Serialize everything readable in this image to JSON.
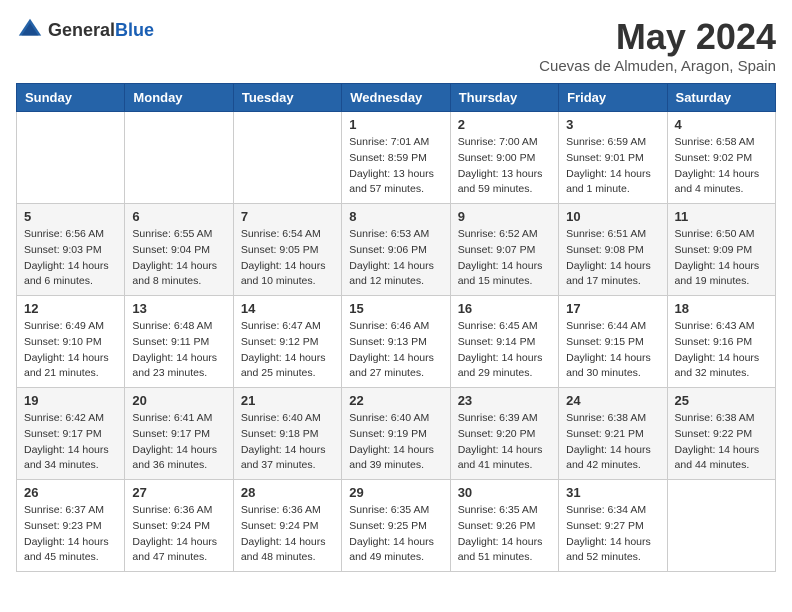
{
  "header": {
    "logo_general": "General",
    "logo_blue": "Blue",
    "month_title": "May 2024",
    "location": "Cuevas de Almuden, Aragon, Spain"
  },
  "weekdays": [
    "Sunday",
    "Monday",
    "Tuesday",
    "Wednesday",
    "Thursday",
    "Friday",
    "Saturday"
  ],
  "weeks": [
    [
      {
        "day": "",
        "info": ""
      },
      {
        "day": "",
        "info": ""
      },
      {
        "day": "",
        "info": ""
      },
      {
        "day": "1",
        "info": "Sunrise: 7:01 AM\nSunset: 8:59 PM\nDaylight: 13 hours\nand 57 minutes."
      },
      {
        "day": "2",
        "info": "Sunrise: 7:00 AM\nSunset: 9:00 PM\nDaylight: 13 hours\nand 59 minutes."
      },
      {
        "day": "3",
        "info": "Sunrise: 6:59 AM\nSunset: 9:01 PM\nDaylight: 14 hours\nand 1 minute."
      },
      {
        "day": "4",
        "info": "Sunrise: 6:58 AM\nSunset: 9:02 PM\nDaylight: 14 hours\nand 4 minutes."
      }
    ],
    [
      {
        "day": "5",
        "info": "Sunrise: 6:56 AM\nSunset: 9:03 PM\nDaylight: 14 hours\nand 6 minutes."
      },
      {
        "day": "6",
        "info": "Sunrise: 6:55 AM\nSunset: 9:04 PM\nDaylight: 14 hours\nand 8 minutes."
      },
      {
        "day": "7",
        "info": "Sunrise: 6:54 AM\nSunset: 9:05 PM\nDaylight: 14 hours\nand 10 minutes."
      },
      {
        "day": "8",
        "info": "Sunrise: 6:53 AM\nSunset: 9:06 PM\nDaylight: 14 hours\nand 12 minutes."
      },
      {
        "day": "9",
        "info": "Sunrise: 6:52 AM\nSunset: 9:07 PM\nDaylight: 14 hours\nand 15 minutes."
      },
      {
        "day": "10",
        "info": "Sunrise: 6:51 AM\nSunset: 9:08 PM\nDaylight: 14 hours\nand 17 minutes."
      },
      {
        "day": "11",
        "info": "Sunrise: 6:50 AM\nSunset: 9:09 PM\nDaylight: 14 hours\nand 19 minutes."
      }
    ],
    [
      {
        "day": "12",
        "info": "Sunrise: 6:49 AM\nSunset: 9:10 PM\nDaylight: 14 hours\nand 21 minutes."
      },
      {
        "day": "13",
        "info": "Sunrise: 6:48 AM\nSunset: 9:11 PM\nDaylight: 14 hours\nand 23 minutes."
      },
      {
        "day": "14",
        "info": "Sunrise: 6:47 AM\nSunset: 9:12 PM\nDaylight: 14 hours\nand 25 minutes."
      },
      {
        "day": "15",
        "info": "Sunrise: 6:46 AM\nSunset: 9:13 PM\nDaylight: 14 hours\nand 27 minutes."
      },
      {
        "day": "16",
        "info": "Sunrise: 6:45 AM\nSunset: 9:14 PM\nDaylight: 14 hours\nand 29 minutes."
      },
      {
        "day": "17",
        "info": "Sunrise: 6:44 AM\nSunset: 9:15 PM\nDaylight: 14 hours\nand 30 minutes."
      },
      {
        "day": "18",
        "info": "Sunrise: 6:43 AM\nSunset: 9:16 PM\nDaylight: 14 hours\nand 32 minutes."
      }
    ],
    [
      {
        "day": "19",
        "info": "Sunrise: 6:42 AM\nSunset: 9:17 PM\nDaylight: 14 hours\nand 34 minutes."
      },
      {
        "day": "20",
        "info": "Sunrise: 6:41 AM\nSunset: 9:17 PM\nDaylight: 14 hours\nand 36 minutes."
      },
      {
        "day": "21",
        "info": "Sunrise: 6:40 AM\nSunset: 9:18 PM\nDaylight: 14 hours\nand 37 minutes."
      },
      {
        "day": "22",
        "info": "Sunrise: 6:40 AM\nSunset: 9:19 PM\nDaylight: 14 hours\nand 39 minutes."
      },
      {
        "day": "23",
        "info": "Sunrise: 6:39 AM\nSunset: 9:20 PM\nDaylight: 14 hours\nand 41 minutes."
      },
      {
        "day": "24",
        "info": "Sunrise: 6:38 AM\nSunset: 9:21 PM\nDaylight: 14 hours\nand 42 minutes."
      },
      {
        "day": "25",
        "info": "Sunrise: 6:38 AM\nSunset: 9:22 PM\nDaylight: 14 hours\nand 44 minutes."
      }
    ],
    [
      {
        "day": "26",
        "info": "Sunrise: 6:37 AM\nSunset: 9:23 PM\nDaylight: 14 hours\nand 45 minutes."
      },
      {
        "day": "27",
        "info": "Sunrise: 6:36 AM\nSunset: 9:24 PM\nDaylight: 14 hours\nand 47 minutes."
      },
      {
        "day": "28",
        "info": "Sunrise: 6:36 AM\nSunset: 9:24 PM\nDaylight: 14 hours\nand 48 minutes."
      },
      {
        "day": "29",
        "info": "Sunrise: 6:35 AM\nSunset: 9:25 PM\nDaylight: 14 hours\nand 49 minutes."
      },
      {
        "day": "30",
        "info": "Sunrise: 6:35 AM\nSunset: 9:26 PM\nDaylight: 14 hours\nand 51 minutes."
      },
      {
        "day": "31",
        "info": "Sunrise: 6:34 AM\nSunset: 9:27 PM\nDaylight: 14 hours\nand 52 minutes."
      },
      {
        "day": "",
        "info": ""
      }
    ]
  ]
}
